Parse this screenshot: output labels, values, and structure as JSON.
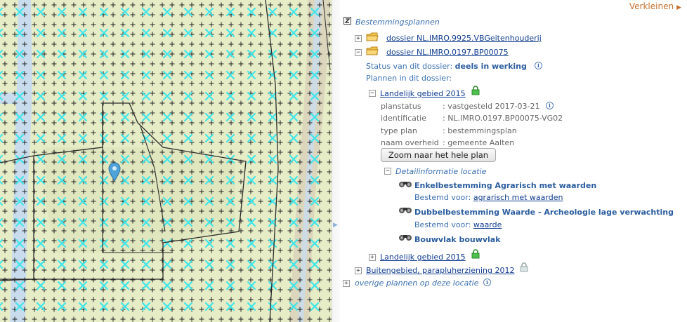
{
  "panel": {
    "collapse_label": "Verkleinen",
    "root_label": "Bestemmingsplannen",
    "dossier1": "dossier NL.IMRO.9925.VBGeitenhouderij",
    "dossier2": "dossier NL.IMRO.0197.BP00075",
    "status_label": "Status van dit dossier:",
    "status_value": "deels in werking",
    "plans_label": "Plannen in dit dossier:",
    "plan1": "Landelijk gebied 2015",
    "meta": [
      {
        "key": "planstatus",
        "value": ": vastgesteld 2017-03-21"
      },
      {
        "key": "identificatie",
        "value": ": NL.IMRO.0197.BP00075-VG02"
      },
      {
        "key": "type plan",
        "value": ": bestemmingsplan"
      },
      {
        "key": "naam overheid",
        "value": ": gemeente Aalten"
      }
    ],
    "zoom_button": "Zoom naar het hele plan",
    "detail_label": "Detailinformatie locatie",
    "items": [
      {
        "title": "Enkelbestemming Agrarisch met waarden",
        "bestemd_label": "Bestemd voor:",
        "bestemd_value": "agrarisch met waarden"
      },
      {
        "title": "Dubbelbestemming Waarde - Archeologie lage verwachting",
        "bestemd_label": "Bestemd voor:",
        "bestemd_value": "waarde"
      },
      {
        "title": "Bouwvlak bouwvlak"
      }
    ],
    "plan2": "Landelijk gebied 2015",
    "plan3": "Buitengebied, parapluherziening 2012",
    "other_plans": "overige plannen op deze locatie"
  },
  "colors": {
    "map_bg": "#e6ecc6",
    "road": "#c8dced",
    "x_mark": "#3fe6ea",
    "link": "#103c8f",
    "accent": "#c8712e",
    "heading": "#2b5d9f"
  },
  "icons": [
    "folder-icon",
    "info-icon",
    "lock-icon",
    "binoculars-icon",
    "map-pin-icon",
    "layers-icon",
    "arrow-right-icon"
  ]
}
